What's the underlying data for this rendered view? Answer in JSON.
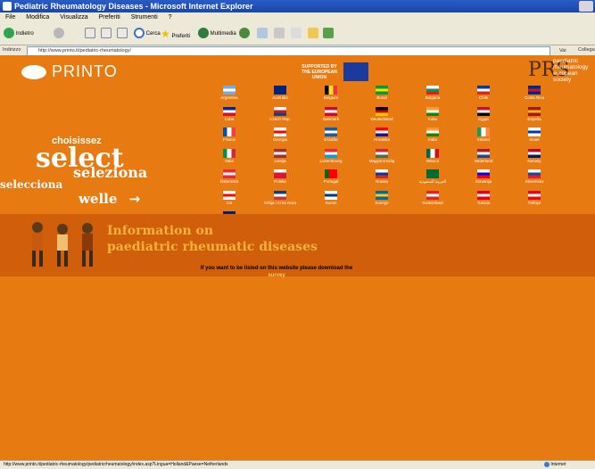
{
  "window": {
    "title": "Pediatric Rheumatology Diseases - Microsoft Internet Explorer"
  },
  "menu": [
    "File",
    "Modifica",
    "Visualizza",
    "Preferiti",
    "Strumenti",
    "?"
  ],
  "toolbar": {
    "back": "Indietro",
    "search": "Cerca",
    "favorites": "Preferiti",
    "media": "Multimedia"
  },
  "address": {
    "label": "Indirizzo",
    "value": "http://www.printo.it/pediatric-rheumatology/",
    "go": "Vai",
    "links": "Collegamenti"
  },
  "header": {
    "printo": "PRINTO",
    "eu_text": "SUPPORTED BY THE EUROPEAN UNION",
    "prs": "PRS",
    "prs_sub": "paediatric rheumatology european society"
  },
  "select": {
    "choisissez": "choisissez",
    "select": "select",
    "seleziona": "seleziona",
    "selecciona": "selecciona",
    "welle": "welle",
    "arrow": "→"
  },
  "flags": [
    {
      "name": "Argentina",
      "colors": [
        "#74acdf",
        "#ffffff",
        "#74acdf"
      ],
      "kind": "h"
    },
    {
      "name": "Australia",
      "colors": [
        "#00247d",
        "#00247d",
        "#00247d"
      ],
      "kind": "h"
    },
    {
      "name": "Belgium",
      "colors": [
        "#000000",
        "#fdda24",
        "#ef3340"
      ],
      "kind": "v"
    },
    {
      "name": "Brasil",
      "colors": [
        "#009c3b",
        "#ffdf00",
        "#009c3b"
      ],
      "kind": "h"
    },
    {
      "name": "Bulgaria",
      "colors": [
        "#ffffff",
        "#00966e",
        "#d62612"
      ],
      "kind": "h"
    },
    {
      "name": "Chile",
      "colors": [
        "#0039a6",
        "#ffffff",
        "#d52b1e"
      ],
      "kind": "h"
    },
    {
      "name": "Costa Rica",
      "colors": [
        "#002b7f",
        "#ce1126",
        "#002b7f"
      ],
      "kind": "h"
    },
    {
      "name": "Cuba",
      "colors": [
        "#002a8f",
        "#ffffff",
        "#cf142b"
      ],
      "kind": "h"
    },
    {
      "name": "Czech Rep.",
      "colors": [
        "#ffffff",
        "#d7141a",
        "#11457e"
      ],
      "kind": "h"
    },
    {
      "name": "Danmark",
      "colors": [
        "#c60c30",
        "#ffffff",
        "#c60c30"
      ],
      "kind": "h"
    },
    {
      "name": "Deutschland",
      "colors": [
        "#000000",
        "#dd0000",
        "#ffce00"
      ],
      "kind": "h"
    },
    {
      "name": "India",
      "colors": [
        "#ff9933",
        "#ffffff",
        "#138808"
      ],
      "kind": "h"
    },
    {
      "name": "Egypt",
      "colors": [
        "#ce1126",
        "#ffffff",
        "#000000"
      ],
      "kind": "h"
    },
    {
      "name": "España",
      "colors": [
        "#aa151b",
        "#f1bf00",
        "#aa151b"
      ],
      "kind": "h"
    },
    {
      "name": "France",
      "colors": [
        "#0055a4",
        "#ffffff",
        "#ef4135"
      ],
      "kind": "v"
    },
    {
      "name": "Georgia",
      "colors": [
        "#ffffff",
        "#ff0000",
        "#ffffff"
      ],
      "kind": "h"
    },
    {
      "name": "Ελλάδα",
      "colors": [
        "#0d5eaf",
        "#ffffff",
        "#0d5eaf"
      ],
      "kind": "h"
    },
    {
      "name": "Hrvatska",
      "colors": [
        "#ff0000",
        "#ffffff",
        "#171796"
      ],
      "kind": "h"
    },
    {
      "name": "India",
      "colors": [
        "#ff9933",
        "#ffffff",
        "#138808"
      ],
      "kind": "h"
    },
    {
      "name": "Ireland",
      "colors": [
        "#169b62",
        "#ffffff",
        "#ff883e"
      ],
      "kind": "v"
    },
    {
      "name": "Israel",
      "colors": [
        "#ffffff",
        "#0038b8",
        "#ffffff"
      ],
      "kind": "h"
    },
    {
      "name": "Italia",
      "colors": [
        "#009246",
        "#ffffff",
        "#ce2b37"
      ],
      "kind": "v"
    },
    {
      "name": "Latvija",
      "colors": [
        "#9e3039",
        "#ffffff",
        "#9e3039"
      ],
      "kind": "h"
    },
    {
      "name": "Luxembourg",
      "colors": [
        "#ed2939",
        "#ffffff",
        "#00a1de"
      ],
      "kind": "h"
    },
    {
      "name": "Magyarország",
      "colors": [
        "#ce2939",
        "#ffffff",
        "#477050"
      ],
      "kind": "h"
    },
    {
      "name": "México",
      "colors": [
        "#006847",
        "#ffffff",
        "#ce1126"
      ],
      "kind": "v"
    },
    {
      "name": "Nederland",
      "colors": [
        "#ae1c28",
        "#ffffff",
        "#21468b"
      ],
      "kind": "h"
    },
    {
      "name": "Norway",
      "colors": [
        "#ba0c2f",
        "#ffffff",
        "#00205b"
      ],
      "kind": "h"
    },
    {
      "name": "Österreich",
      "colors": [
        "#ed2939",
        "#ffffff",
        "#ed2939"
      ],
      "kind": "h"
    },
    {
      "name": "Polska",
      "colors": [
        "#ffffff",
        "#dc143c",
        "#dc143c"
      ],
      "kind": "h"
    },
    {
      "name": "Portugal",
      "colors": [
        "#006600",
        "#ff0000",
        "#ff0000"
      ],
      "kind": "v"
    },
    {
      "name": "Russia",
      "colors": [
        "#ffffff",
        "#0039a6",
        "#d52b1e"
      ],
      "kind": "h"
    },
    {
      "name": "العربية السعودية",
      "colors": [
        "#006c35",
        "#006c35",
        "#006c35"
      ],
      "kind": "h"
    },
    {
      "name": "Slovenija",
      "colors": [
        "#ffffff",
        "#0000ff",
        "#ff0000"
      ],
      "kind": "h"
    },
    {
      "name": "Slovensko",
      "colors": [
        "#ffffff",
        "#0b4ea2",
        "#ee1c25"
      ],
      "kind": "h"
    },
    {
      "name": "CS",
      "colors": [
        "#ffffff",
        "#ff0000",
        "#ffffff"
      ],
      "kind": "h"
    },
    {
      "name": "Srbija i Crna Gora",
      "colors": [
        "#0c4077",
        "#ffffff",
        "#c6363c"
      ],
      "kind": "h"
    },
    {
      "name": "Suomi",
      "colors": [
        "#ffffff",
        "#003580",
        "#ffffff"
      ],
      "kind": "h"
    },
    {
      "name": "Sverige",
      "colors": [
        "#006aa7",
        "#fecc00",
        "#006aa7"
      ],
      "kind": "h"
    },
    {
      "name": "Switzerland",
      "colors": [
        "#d52b1e",
        "#ffffff",
        "#d52b1e"
      ],
      "kind": "h"
    },
    {
      "name": "Tunisia",
      "colors": [
        "#e70013",
        "#ffffff",
        "#e70013"
      ],
      "kind": "h"
    },
    {
      "name": "Türkiye",
      "colors": [
        "#e30a17",
        "#ffffff",
        "#e30a17"
      ],
      "kind": "h"
    },
    {
      "name": "UK",
      "colors": [
        "#012169",
        "#ffffff",
        "#c8102e"
      ],
      "kind": "h"
    }
  ],
  "info": {
    "line1": "Information on",
    "line2": "paediatric rheumatic diseases"
  },
  "survey": {
    "text": "If you want to be listed on this website please download the",
    "link": "survey"
  },
  "status": {
    "url": "http://www.printo.it/pediatric-rheumatology/pediatricrheumatology/index.asp?Lingua=Holland&Paese=Netherlands",
    "zone": "Internet"
  }
}
